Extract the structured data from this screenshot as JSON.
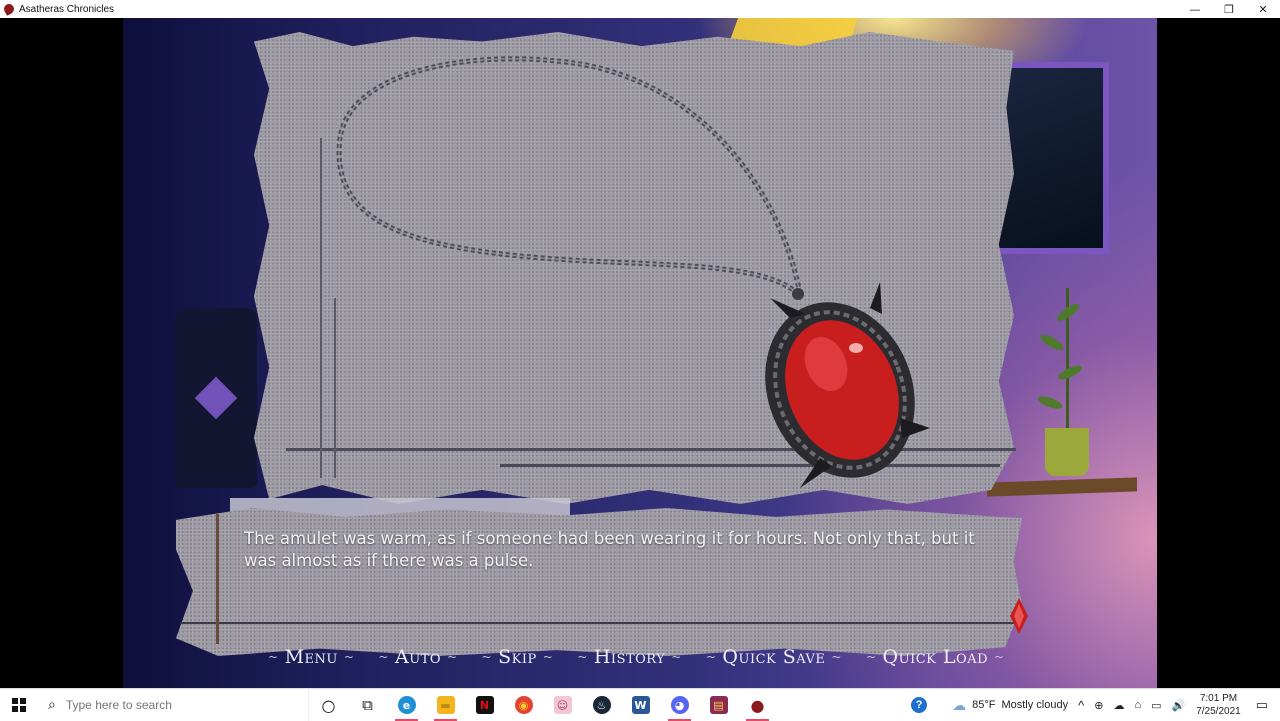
{
  "window": {
    "title": "Asatheras Chronicles",
    "minimize_glyph": "—",
    "restore_glyph": "❐",
    "close_glyph": "✕"
  },
  "dialogue": {
    "text": "The amulet was warm, as if someone had been wearing it for hours. Not only that, but it was almost as if there was a pulse."
  },
  "quick_menu": {
    "flourish": "~",
    "items": [
      {
        "label": "Menu"
      },
      {
        "label": "Auto"
      },
      {
        "label": "Skip"
      },
      {
        "label": "History"
      },
      {
        "label": "Quick Save"
      },
      {
        "label": "Quick Load"
      }
    ]
  },
  "taskbar": {
    "search_placeholder": "Type here to search",
    "apps": [
      {
        "icon": "cortana-icon",
        "glyph": "○",
        "color": "#111111"
      },
      {
        "icon": "task-view-icon",
        "glyph": "⧉",
        "color": "#111111"
      },
      {
        "icon": "edge-icon",
        "glyph": "e",
        "color": "#1f8fd6"
      },
      {
        "icon": "file-explorer-icon",
        "glyph": "▬",
        "color": "#f2b51d"
      },
      {
        "icon": "netflix-icon",
        "glyph": "N",
        "color": "#e50914"
      },
      {
        "icon": "chrome-icon",
        "glyph": "◉",
        "color": "#e3432e"
      },
      {
        "icon": "character-app-icon",
        "glyph": "☺",
        "color": "#e58fa8"
      },
      {
        "icon": "steam-icon",
        "glyph": "♨",
        "color": "#1b2838"
      },
      {
        "icon": "word-icon",
        "glyph": "W",
        "color": "#2b5797"
      },
      {
        "icon": "discord-icon",
        "glyph": "◕",
        "color": "#5865f2"
      },
      {
        "icon": "winrar-icon",
        "glyph": "▤",
        "color": "#8b2a52"
      },
      {
        "icon": "asatheras-app-icon",
        "glyph": "●",
        "color": "#8b1a1a"
      }
    ],
    "weather": {
      "temp": "85°F",
      "condition": "Mostly cloudy"
    },
    "help_glyph": "?",
    "tray_chevron": "^",
    "tray_glyphs": [
      "⊕",
      "☁",
      "⌂",
      "▭",
      "🔊"
    ],
    "notification_glyph": "▭",
    "clock": {
      "time": "7:01 PM",
      "date": "7/25/2021"
    }
  },
  "colors": {
    "gem": "#c81e1e",
    "accent_purple": "#7c56c0",
    "dialogue_text": "#f2f2f2"
  }
}
